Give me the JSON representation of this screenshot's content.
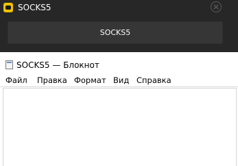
{
  "vpn_window": {
    "title": "SOCKS5",
    "button_label": "SOCKS5",
    "logo_icon": "app-logo-icon",
    "close_icon": "close-icon",
    "colors": {
      "background": "#272727",
      "button": "#363636",
      "logo": "#f2c200"
    }
  },
  "notepad": {
    "title": "SOCKS5 — Блокнот",
    "icon": "notepad-icon",
    "menu": [
      "Файл",
      "Правка",
      "Формат",
      "Вид",
      "Справка"
    ],
    "content": ""
  }
}
